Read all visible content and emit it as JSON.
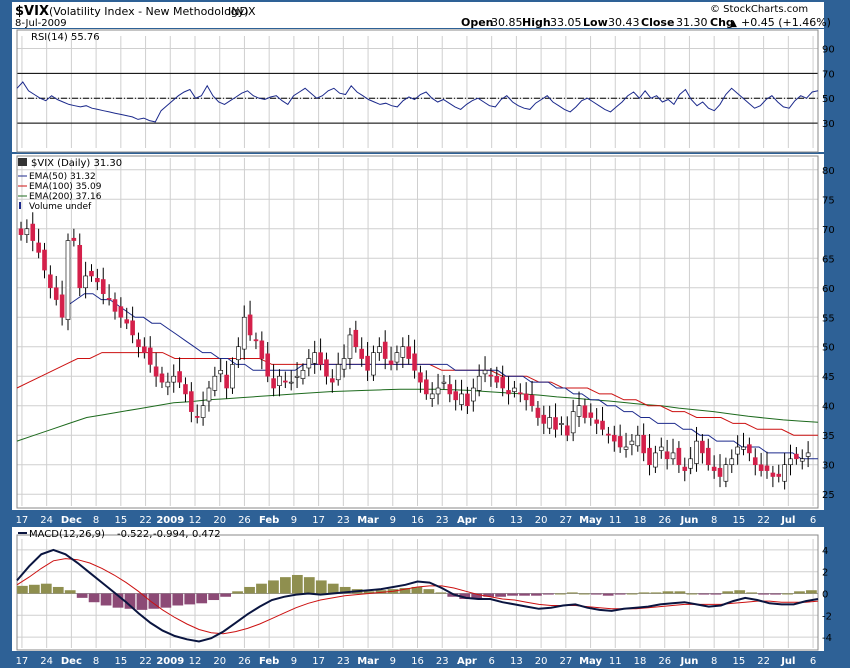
{
  "header": {
    "symbol": "$VIX",
    "name": "(Volatility Index - New Methodology)",
    "exchange": "INDX",
    "date": "8-Jul-2009",
    "brand": "© StockCharts.com",
    "open_label": "Open",
    "open": "30.85",
    "high_label": "High",
    "high": "33.05",
    "low_label": "Low",
    "low": "30.43",
    "close_label": "Close",
    "close": "31.30",
    "chg_label": "Chg",
    "chg": "+0.45 (+1.46%)",
    "chg_arrow": "▲"
  },
  "legend": {
    "rsi": "RSI(14) 55.76",
    "price": "$VIX (Daily) 31.30",
    "ema50": "EMA(50) 31.32",
    "ema100": "EMA(100) 35.09",
    "ema200": "EMA(200) 37.16",
    "volume": "Volume undef",
    "macd_label": "MACD(12,26,9)",
    "macd_v1": "-0.522,",
    "macd_v2": "-0.994,",
    "macd_v3": "0.472"
  },
  "colors": {
    "frame": "#2e6196",
    "up": "#ffffff",
    "down": "#d4204a",
    "ema50": "#1c2a8c",
    "ema100": "#cc1111",
    "ema200": "#1d6a1d",
    "hist_pos": "#8f8f4f",
    "hist_neg": "#8c4a76"
  },
  "chart_data": [
    {
      "type": "line",
      "panel": "RSI",
      "series": [
        {
          "name": "RSI(14)",
          "values": [
            58,
            63,
            56,
            53,
            50,
            48,
            52,
            49,
            47,
            45,
            44,
            43,
            44,
            42,
            41,
            40,
            39,
            38,
            37,
            36,
            35,
            33,
            34,
            32,
            31,
            40,
            44,
            48,
            52,
            55,
            57,
            50,
            52,
            60,
            52,
            47,
            45,
            48,
            51,
            54,
            56,
            52,
            50,
            49,
            51,
            52,
            48,
            45,
            52,
            55,
            58,
            54,
            50,
            52,
            56,
            58,
            54,
            53,
            60,
            55,
            52,
            49,
            47,
            45,
            46,
            44,
            43,
            48,
            51,
            49,
            53,
            55,
            50,
            47,
            49,
            46,
            43,
            41,
            45,
            48,
            50,
            47,
            44,
            43,
            49,
            52,
            47,
            44,
            42,
            41,
            46,
            49,
            52,
            47,
            44,
            41,
            39,
            43,
            48,
            50,
            47,
            44,
            41,
            39,
            43,
            47,
            52,
            55,
            50,
            56,
            50,
            52,
            47,
            49,
            45,
            53,
            57,
            49,
            44,
            47,
            42,
            40,
            45,
            53,
            58,
            54,
            50,
            46,
            42,
            44,
            49,
            52,
            47,
            43,
            42,
            48,
            52,
            50,
            55,
            56
          ]
        }
      ],
      "yticks": [
        30,
        50,
        70,
        90
      ],
      "ylim": [
        10,
        100
      ]
    },
    {
      "type": "candlestick",
      "panel": "Price",
      "x_labels": [
        "17",
        "24",
        "Dec",
        "8",
        "15",
        "22",
        "2009",
        "12",
        "20",
        "26",
        "Feb",
        "9",
        "17",
        "23",
        "Mar",
        "9",
        "16",
        "23",
        "Apr",
        "6",
        "13",
        "20",
        "27",
        "May",
        "11",
        "18",
        "26",
        "Jun",
        "8",
        "15",
        "22",
        "Jul",
        "6"
      ],
      "yticks": [
        25,
        30,
        35,
        40,
        45,
        50,
        55,
        60,
        65,
        70,
        75,
        80
      ],
      "ylim": [
        23,
        82
      ],
      "close": [
        69,
        70,
        68,
        66,
        63,
        60,
        58,
        55,
        68,
        68,
        60,
        62,
        62,
        61,
        59,
        58,
        56,
        55,
        54,
        52,
        50,
        49,
        47,
        45,
        44,
        44,
        45,
        44,
        42,
        39,
        38,
        40,
        43,
        45,
        46,
        43,
        47,
        50,
        55,
        52,
        51,
        48,
        45,
        43,
        45,
        44,
        44,
        45,
        46,
        48,
        49,
        47,
        45,
        44,
        47,
        48,
        52,
        50,
        48,
        46,
        49,
        50,
        48,
        47,
        49,
        50,
        48,
        46,
        44,
        42,
        42,
        43,
        44,
        42,
        41,
        42,
        40,
        43,
        45,
        46,
        45,
        44,
        43,
        42,
        43,
        42,
        41,
        40,
        38,
        37,
        38,
        36,
        37,
        35,
        39,
        40,
        38,
        38,
        37,
        36,
        35,
        34,
        33,
        33,
        34,
        35,
        32,
        30,
        32,
        33,
        31,
        32,
        30,
        29,
        31,
        34,
        32,
        30,
        29,
        28,
        30,
        31,
        33,
        33,
        32,
        30,
        29,
        29,
        28,
        28,
        30,
        31,
        31,
        31,
        32
      ],
      "series": [
        {
          "name": "EMA(50)",
          "values": [
            null,
            null,
            null,
            null,
            null,
            null,
            57,
            58,
            59,
            59,
            58,
            58,
            57,
            56,
            55,
            55,
            54,
            54,
            53,
            52,
            51,
            50,
            49,
            49,
            48,
            48,
            47,
            47,
            46,
            46,
            46,
            46,
            46,
            46,
            47,
            47,
            47,
            47,
            47,
            47,
            47,
            47,
            47,
            47,
            47,
            47,
            47,
            47,
            47,
            47,
            47,
            47,
            46,
            46,
            46,
            46,
            46,
            46,
            45,
            45,
            45,
            44,
            44,
            44,
            43,
            43,
            42,
            42,
            41,
            41,
            40,
            40,
            39,
            39,
            38,
            38,
            37,
            37,
            37,
            36,
            36,
            35,
            35,
            34,
            34,
            34,
            33,
            33,
            33,
            32,
            32,
            32,
            32,
            31,
            31,
            31
          ]
        },
        {
          "name": "EMA(100)",
          "values": [
            43,
            44,
            45,
            46,
            47,
            48,
            48,
            49,
            49,
            49,
            49,
            49,
            49,
            48,
            48,
            48,
            48,
            48,
            48,
            48,
            48,
            47,
            47,
            47,
            47,
            47,
            47,
            47,
            47,
            47,
            47,
            47,
            47,
            47,
            47,
            46,
            46,
            46,
            46,
            46,
            45,
            45,
            45,
            44,
            44,
            43,
            43,
            43,
            42,
            42,
            41,
            41,
            40,
            40,
            39,
            39,
            38,
            38,
            38,
            37,
            37,
            36,
            36,
            36,
            35,
            35,
            35
          ]
        },
        {
          "name": "EMA(200)",
          "values": [
            34,
            35,
            36,
            37,
            38,
            38.5,
            39,
            39.5,
            40,
            40.5,
            40.7,
            41,
            41.2,
            41.4,
            41.6,
            41.8,
            42,
            42.2,
            42.4,
            42.5,
            42.6,
            42.7,
            42.8,
            42.8,
            42.8,
            42.7,
            42.6,
            42.4,
            42.2,
            42,
            41.8,
            41.5,
            41.3,
            41,
            40.8,
            40.5,
            40.2,
            40,
            39.6,
            39.3,
            39,
            38.6,
            38.2,
            37.9,
            37.6,
            37.4,
            37.2
          ]
        }
      ]
    },
    {
      "type": "line",
      "panel": "MACD",
      "yticks": [
        -4,
        -2,
        0,
        2,
        4
      ],
      "ylim": [
        -5,
        5
      ],
      "series": [
        {
          "name": "MACD",
          "values": [
            1.2,
            2.5,
            3.6,
            4.0,
            3.6,
            2.8,
            1.9,
            1.0,
            0.1,
            -0.8,
            -1.8,
            -2.7,
            -3.4,
            -3.9,
            -4.2,
            -4.4,
            -4.1,
            -3.5,
            -2.7,
            -1.9,
            -1.2,
            -0.6,
            -0.3,
            -0.1,
            0.0,
            -0.1,
            0.0,
            0.1,
            0.2,
            0.3,
            0.4,
            0.6,
            0.8,
            1.1,
            1.0,
            0.5,
            -0.1,
            -0.4,
            -0.5,
            -0.5,
            -0.8,
            -1.0,
            -1.2,
            -1.4,
            -1.3,
            -1.1,
            -1.0,
            -1.3,
            -1.5,
            -1.6,
            -1.4,
            -1.3,
            -1.2,
            -1.0,
            -0.9,
            -0.8,
            -1.0,
            -1.2,
            -1.1,
            -0.7,
            -0.4,
            -0.6,
            -0.9,
            -1.0,
            -1.0,
            -0.7,
            -0.5
          ]
        },
        {
          "name": "Signal",
          "values": [
            0.8,
            1.5,
            2.3,
            3.0,
            3.2,
            3.1,
            2.8,
            2.3,
            1.7,
            1.0,
            0.2,
            -0.7,
            -1.5,
            -2.2,
            -2.8,
            -3.3,
            -3.6,
            -3.7,
            -3.5,
            -3.2,
            -2.8,
            -2.3,
            -1.8,
            -1.3,
            -0.9,
            -0.6,
            -0.4,
            -0.2,
            -0.1,
            0.0,
            0.1,
            0.2,
            0.4,
            0.6,
            0.7,
            0.7,
            0.5,
            0.2,
            -0.1,
            -0.3,
            -0.5,
            -0.6,
            -0.8,
            -1.0,
            -1.1,
            -1.1,
            -1.1,
            -1.2,
            -1.3,
            -1.4,
            -1.4,
            -1.4,
            -1.3,
            -1.2,
            -1.1,
            -1.0,
            -1.0,
            -1.0,
            -1.0,
            -0.9,
            -0.8,
            -0.7,
            -0.7,
            -0.8,
            -0.8,
            -0.8,
            -0.7
          ]
        },
        {
          "name": "Histogram",
          "values": [
            0.7,
            0.8,
            0.9,
            0.6,
            0.3,
            -0.4,
            -0.8,
            -1.1,
            -1.3,
            -1.4,
            -1.5,
            -1.4,
            -1.3,
            -1.1,
            -1.0,
            -0.9,
            -0.6,
            -0.3,
            0.2,
            0.6,
            0.9,
            1.2,
            1.5,
            1.7,
            1.5,
            1.2,
            0.9,
            0.6,
            0.4,
            0.2,
            0.3,
            0.4,
            0.5,
            0.6,
            0.4,
            0.1,
            -0.3,
            -0.5,
            -0.5,
            -0.3,
            -0.3,
            -0.2,
            -0.2,
            -0.2,
            -0.1,
            0.0,
            0.1,
            0.0,
            -0.1,
            -0.2,
            -0.1,
            0.0,
            0.1,
            0.1,
            0.2,
            0.2,
            0.0,
            -0.1,
            -0.1,
            0.2,
            0.3,
            0.1,
            -0.1,
            -0.1,
            0.0,
            0.2,
            0.3
          ]
        }
      ]
    }
  ]
}
